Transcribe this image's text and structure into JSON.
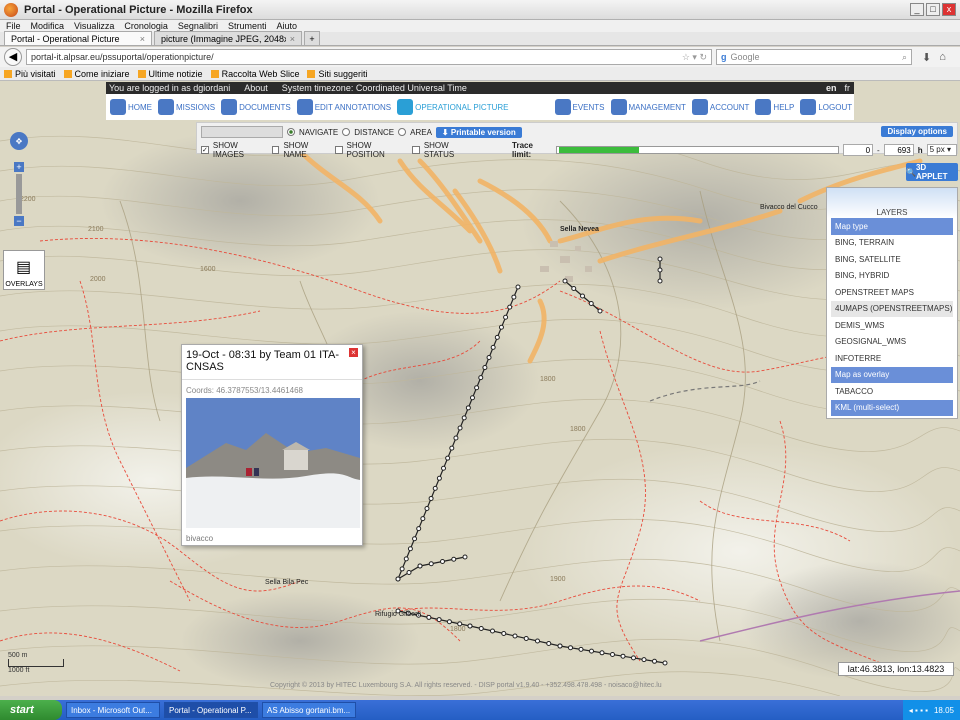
{
  "browser": {
    "title": "Portal - Operational Picture - Mozilla Firefox",
    "menu": [
      "File",
      "Modifica",
      "Visualizza",
      "Cronologia",
      "Segnalibri",
      "Strumenti",
      "Aiuto"
    ],
    "tabs": [
      {
        "label": "Portal - Operational Picture"
      },
      {
        "label": "picture (Immagine JPEG, 2048x1536 pixe..."
      }
    ],
    "url": "portal-it.alpsar.eu/pssuportal/operationpicture/",
    "search_placeholder": "Google",
    "bookmarks": [
      "Più visitati",
      "Come iniziare",
      "Ultime notizie",
      "Raccolta Web Slice",
      "Siti suggeriti"
    ]
  },
  "portal": {
    "logged": "You are logged in as dgiordani",
    "about": "About",
    "timezone": "System timezone: Coordinated Universal Time",
    "langs": [
      "en",
      "fr"
    ],
    "nav": [
      {
        "label": "HOME",
        "icon": "home-icon"
      },
      {
        "label": "MISSIONS",
        "icon": "globe-icon"
      },
      {
        "label": "DOCUMENTS",
        "icon": "document-icon"
      },
      {
        "label": "EDIT ANNOTATIONS",
        "icon": "crosshair-icon"
      },
      {
        "label": "OPERATIONAL PICTURE",
        "icon": "map-icon"
      },
      {
        "label": "EVENTS",
        "icon": "warning-icon"
      },
      {
        "label": "MANAGEMENT",
        "icon": "hierarchy-icon"
      },
      {
        "label": "ACCOUNT",
        "icon": "users-icon"
      },
      {
        "label": "HELP",
        "icon": "question-icon"
      },
      {
        "label": "LOGOUT",
        "icon": "power-icon"
      }
    ]
  },
  "toolbar": {
    "navigate": "NAVIGATE",
    "distance": "DISTANCE",
    "area": "AREA",
    "printable": "Printable version",
    "show_images": "SHOW IMAGES",
    "show_name": "SHOW NAME",
    "show_position": "SHOW POSITION",
    "show_status": "SHOW STATUS",
    "trace_limit": "Trace limit:",
    "trace_fill": 0.27,
    "min": "0",
    "dash": "-",
    "max": "693",
    "unit": "h",
    "px": "5 px",
    "display_options": "Display options"
  },
  "applet": "3D APPLET",
  "layers": {
    "title": "LAYERS",
    "items": [
      {
        "label": "Map type",
        "kind": "head"
      },
      {
        "label": "BING, TERRAIN",
        "kind": "item"
      },
      {
        "label": "BING, SATELLITE",
        "kind": "item"
      },
      {
        "label": "BING, HYBRID",
        "kind": "item"
      },
      {
        "label": "OPENSTREET MAPS",
        "kind": "item"
      },
      {
        "label": "4UMAPS (OPENSTREETMAPS)",
        "kind": "sel"
      },
      {
        "label": "DEMIS_WMS",
        "kind": "item"
      },
      {
        "label": "GEOSIGNAL_WMS",
        "kind": "item"
      },
      {
        "label": "INFOTERRE",
        "kind": "item"
      },
      {
        "label": "Map as overlay",
        "kind": "head"
      },
      {
        "label": "TABACCO",
        "kind": "item"
      },
      {
        "label": "KML (multi-select)",
        "kind": "head"
      }
    ]
  },
  "popup": {
    "title": "19-Oct - 08:31 by Team 01 ITA-CNSAS",
    "coords": "Coords: 46.3787553/13.4461468",
    "caption": "bivacco"
  },
  "overlays": "OVERLAYS",
  "map": {
    "place_sella": "Sella Nevea",
    "place_rifugio": "Rifugio Gilberti",
    "place_bila": "Sella Bila Pec",
    "place_bivacco": "Bivacco del Cucco",
    "contour_labels": [
      "2100",
      "2000",
      "1900",
      "1800",
      "1700",
      "1600",
      "1500",
      "1400",
      "2200"
    ],
    "coord_readout": "lat:46.3813, lon:13.4823",
    "scale_top": "500 m",
    "scale_bottom": "1000 ft",
    "copyright": "Copyright © 2013 by HITEC Luxembourg S.A. All rights reserved. - DISP portal v1.9.40 - +352.498.478.498 - noisaco@hitec.lu"
  },
  "taskbar": {
    "start": "start",
    "items": [
      "Inbox - Microsoft Out...",
      "Portal - Operational P...",
      "AS Abisso gortani.bm..."
    ],
    "time": "18.05"
  }
}
